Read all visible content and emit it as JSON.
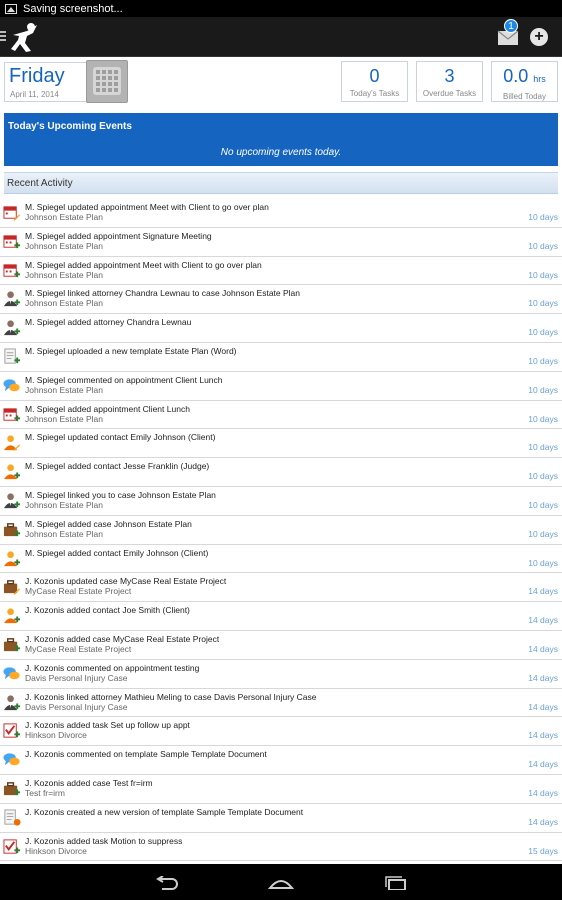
{
  "status_bar": {
    "text": "Saving screenshot..."
  },
  "action_bar": {
    "mail_badge": "1",
    "add_label": "+"
  },
  "header": {
    "day": "Friday",
    "date": "April 11, 2014",
    "stats": [
      {
        "value": "0",
        "unit": "",
        "label": "Today's Tasks"
      },
      {
        "value": "3",
        "unit": "",
        "label": "Overdue Tasks"
      },
      {
        "value": "0.0",
        "unit": "hrs",
        "label": "Billed Today"
      }
    ]
  },
  "events": {
    "title": "Today's Upcoming Events",
    "empty_text": "No upcoming events today."
  },
  "recent": {
    "title": "Recent Activity"
  },
  "activity": [
    {
      "icon": "calendar-edit-icon",
      "text": "M. Spiegel updated appointment Meet with Client to go over plan",
      "sub": "Johnson Estate Plan",
      "when": "10 days"
    },
    {
      "icon": "calendar-add-icon",
      "text": "M. Spiegel added appointment Signature Meeting",
      "sub": "Johnson Estate Plan",
      "when": "10 days"
    },
    {
      "icon": "calendar-add-icon",
      "text": "M. Spiegel added appointment Meet with Client to go over plan",
      "sub": "Johnson Estate Plan",
      "when": "10 days"
    },
    {
      "icon": "attorney-add-icon",
      "text": "M. Spiegel linked attorney Chandra Lewnau to case Johnson Estate Plan",
      "sub": "Johnson Estate Plan",
      "when": "10 days"
    },
    {
      "icon": "attorney-add-icon",
      "text": "M. Spiegel added attorney Chandra Lewnau",
      "sub": "",
      "when": "10 days"
    },
    {
      "icon": "document-add-icon",
      "text": "M. Spiegel uploaded a new template Estate Plan (Word)",
      "sub": "",
      "when": "10 days"
    },
    {
      "icon": "comment-icon",
      "text": "M. Spiegel commented on appointment Client Lunch",
      "sub": "Johnson Estate Plan",
      "when": "10 days"
    },
    {
      "icon": "calendar-add-icon",
      "text": "M. Spiegel added appointment Client Lunch",
      "sub": "Johnson Estate Plan",
      "when": "10 days"
    },
    {
      "icon": "contact-edit-icon",
      "text": "M. Spiegel updated contact Emily Johnson (Client)",
      "sub": "",
      "when": "10 days"
    },
    {
      "icon": "contact-add-icon",
      "text": "M. Spiegel added contact Jesse Franklin (Judge)",
      "sub": "",
      "when": "10 days"
    },
    {
      "icon": "attorney-add-icon",
      "text": "M. Spiegel linked you to case Johnson Estate Plan",
      "sub": "Johnson Estate Plan",
      "when": "10 days"
    },
    {
      "icon": "case-add-icon",
      "text": "M. Spiegel added case Johnson Estate Plan",
      "sub": "Johnson Estate Plan",
      "when": "10 days"
    },
    {
      "icon": "contact-add-icon",
      "text": "M. Spiegel added contact Emily Johnson (Client)",
      "sub": "",
      "when": "10 days"
    },
    {
      "icon": "case-edit-icon",
      "text": "J. Kozonis updated case MyCase Real Estate Project",
      "sub": "MyCase Real Estate Project",
      "when": "14 days"
    },
    {
      "icon": "contact-add-icon",
      "text": "J. Kozonis added contact Joe Smith (Client)",
      "sub": "",
      "when": "14 days"
    },
    {
      "icon": "case-add-icon",
      "text": "J. Kozonis added case MyCase Real Estate Project",
      "sub": "MyCase Real Estate Project",
      "when": "14 days"
    },
    {
      "icon": "comment-icon",
      "text": "J. Kozonis commented on appointment testing",
      "sub": "Davis Personal Injury Case",
      "when": "14 days"
    },
    {
      "icon": "attorney-add-icon",
      "text": "J. Kozonis linked attorney Mathieu Meling to case Davis Personal Injury Case",
      "sub": "Davis Personal Injury Case",
      "when": "14 days"
    },
    {
      "icon": "task-add-icon",
      "text": "J. Kozonis added task Set up follow up appt",
      "sub": "Hinkson Divorce",
      "when": "14 days"
    },
    {
      "icon": "comment-icon",
      "text": "J. Kozonis commented on template Sample Template Document",
      "sub": "",
      "when": "14 days"
    },
    {
      "icon": "case-add-icon",
      "text": "J. Kozonis added case Test fr=irm",
      "sub": "Test fr=irm",
      "when": "14 days"
    },
    {
      "icon": "document-version-icon",
      "text": "J. Kozonis created a new version of template Sample Template Document",
      "sub": "",
      "when": "14 days"
    },
    {
      "icon": "task-add-icon",
      "text": "J. Kozonis added task Motion to suppress",
      "sub": "Hinkson Divorce",
      "when": "15 days"
    }
  ],
  "colors": {
    "accent": "#1565c0",
    "time": "#6a9fd4",
    "bar": "#1a1a1a"
  }
}
